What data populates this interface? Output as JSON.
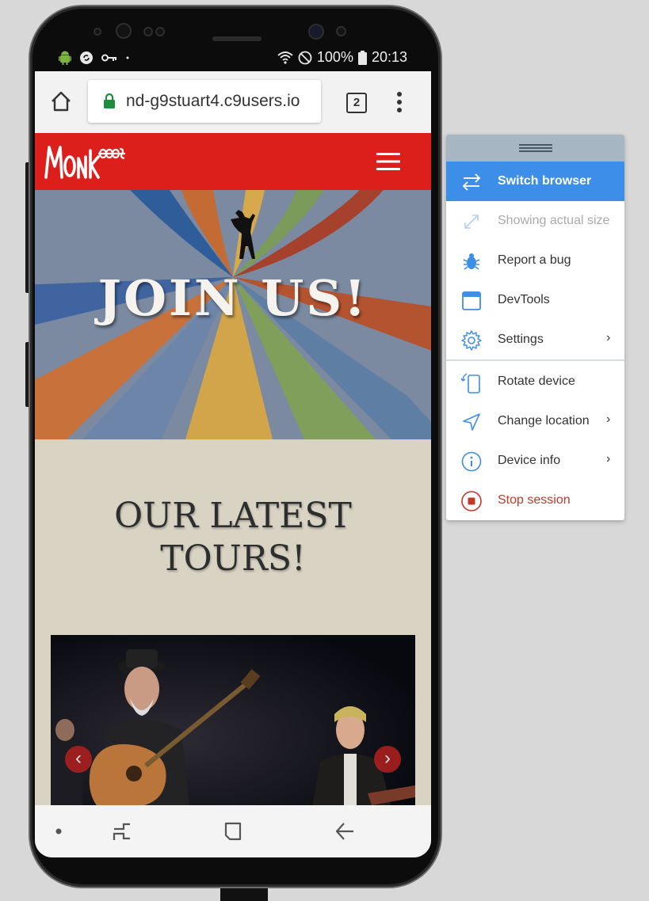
{
  "status_bar": {
    "battery": "100%",
    "time": "20:13"
  },
  "browser": {
    "url": "nd-g9stuart4.c9users.io",
    "tab_count": "2"
  },
  "site": {
    "logo_text": "Monkees",
    "hero_title": "JOIN US!",
    "tours_title_line1": "OUR LATEST",
    "tours_title_line2": "TOURS!",
    "brand_color": "#dd1f1b"
  },
  "menu": {
    "items": [
      {
        "label": "Switch browser",
        "icon": "switch-arrows-icon",
        "state": "active"
      },
      {
        "label": "Showing actual size",
        "icon": "resize-icon",
        "state": "disabled"
      },
      {
        "label": "Report a bug",
        "icon": "bug-icon",
        "state": "normal"
      },
      {
        "label": "DevTools",
        "icon": "window-icon",
        "state": "normal"
      },
      {
        "label": "Settings",
        "icon": "gear-icon",
        "state": "normal",
        "submenu": true
      },
      {
        "label": "Rotate device",
        "icon": "rotate-device-icon",
        "state": "normal"
      },
      {
        "label": "Change location",
        "icon": "location-arrow-icon",
        "state": "normal",
        "submenu": true
      },
      {
        "label": "Device info",
        "icon": "info-icon",
        "state": "normal",
        "submenu": true
      },
      {
        "label": "Stop session",
        "icon": "stop-icon",
        "state": "danger"
      }
    ],
    "active_color": "#3d8ee8",
    "stop_color": "#c0392b"
  }
}
